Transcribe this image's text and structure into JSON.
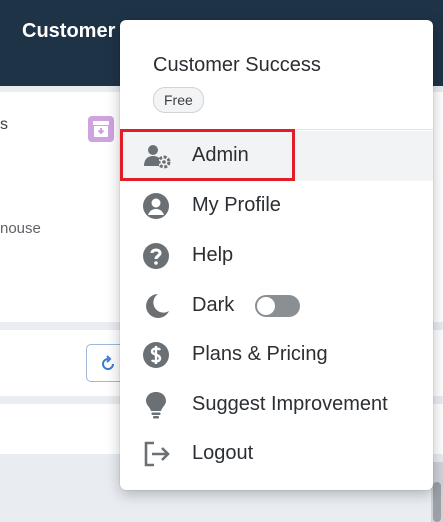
{
  "background": {
    "topbar_title": "Customer",
    "card_text_fragment_1": "s",
    "card_text_fragment_2": "nouse"
  },
  "menu": {
    "org_name": "Customer Success",
    "plan_badge": "Free",
    "items": [
      {
        "label": "Admin",
        "icon": "user-gear-icon",
        "active": true,
        "highlighted": true
      },
      {
        "label": "My Profile",
        "icon": "user-circle-icon"
      },
      {
        "label": "Help",
        "icon": "question-circle-icon"
      },
      {
        "label": "Dark",
        "icon": "moon-icon",
        "toggle": "off"
      },
      {
        "label": "Plans & Pricing",
        "icon": "dollar-circle-icon"
      },
      {
        "label": "Suggest Improvement",
        "icon": "lightbulb-icon"
      },
      {
        "label": "Logout",
        "icon": "logout-icon"
      }
    ]
  },
  "colors": {
    "topbar": "#1f3347",
    "highlight": "#e11d2a",
    "icon": "#6b7075",
    "archive_icon": "#cfa3e0"
  }
}
